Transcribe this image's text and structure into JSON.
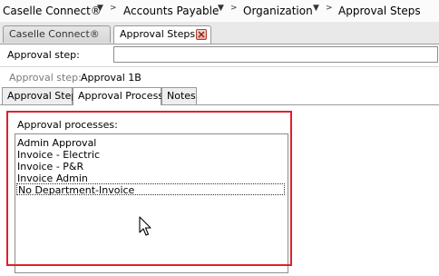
{
  "breadcrumb": {
    "items": [
      "Caselle Connect®",
      "Accounts Payable",
      "Organization",
      "Approval Steps"
    ]
  },
  "doc_tabs": {
    "caselle": "Caselle Connect®",
    "approval_steps": "Approval Steps"
  },
  "approval_step_input": {
    "label": "Approval step:",
    "value": ""
  },
  "readonly": {
    "label": "Approval step:",
    "value": "Approval 1B"
  },
  "inner_tabs": [
    "Approval Step",
    "Approval Process",
    "Notes"
  ],
  "processes": {
    "label": "Approval processes:",
    "items": [
      "Admin Approval",
      "Invoice - Electric",
      "Invoice - P&R",
      "Invoice Admin",
      "No Department-Invoice"
    ]
  },
  "colors": {
    "highlight": "#e0202a",
    "close_button": "#b03a2e"
  }
}
